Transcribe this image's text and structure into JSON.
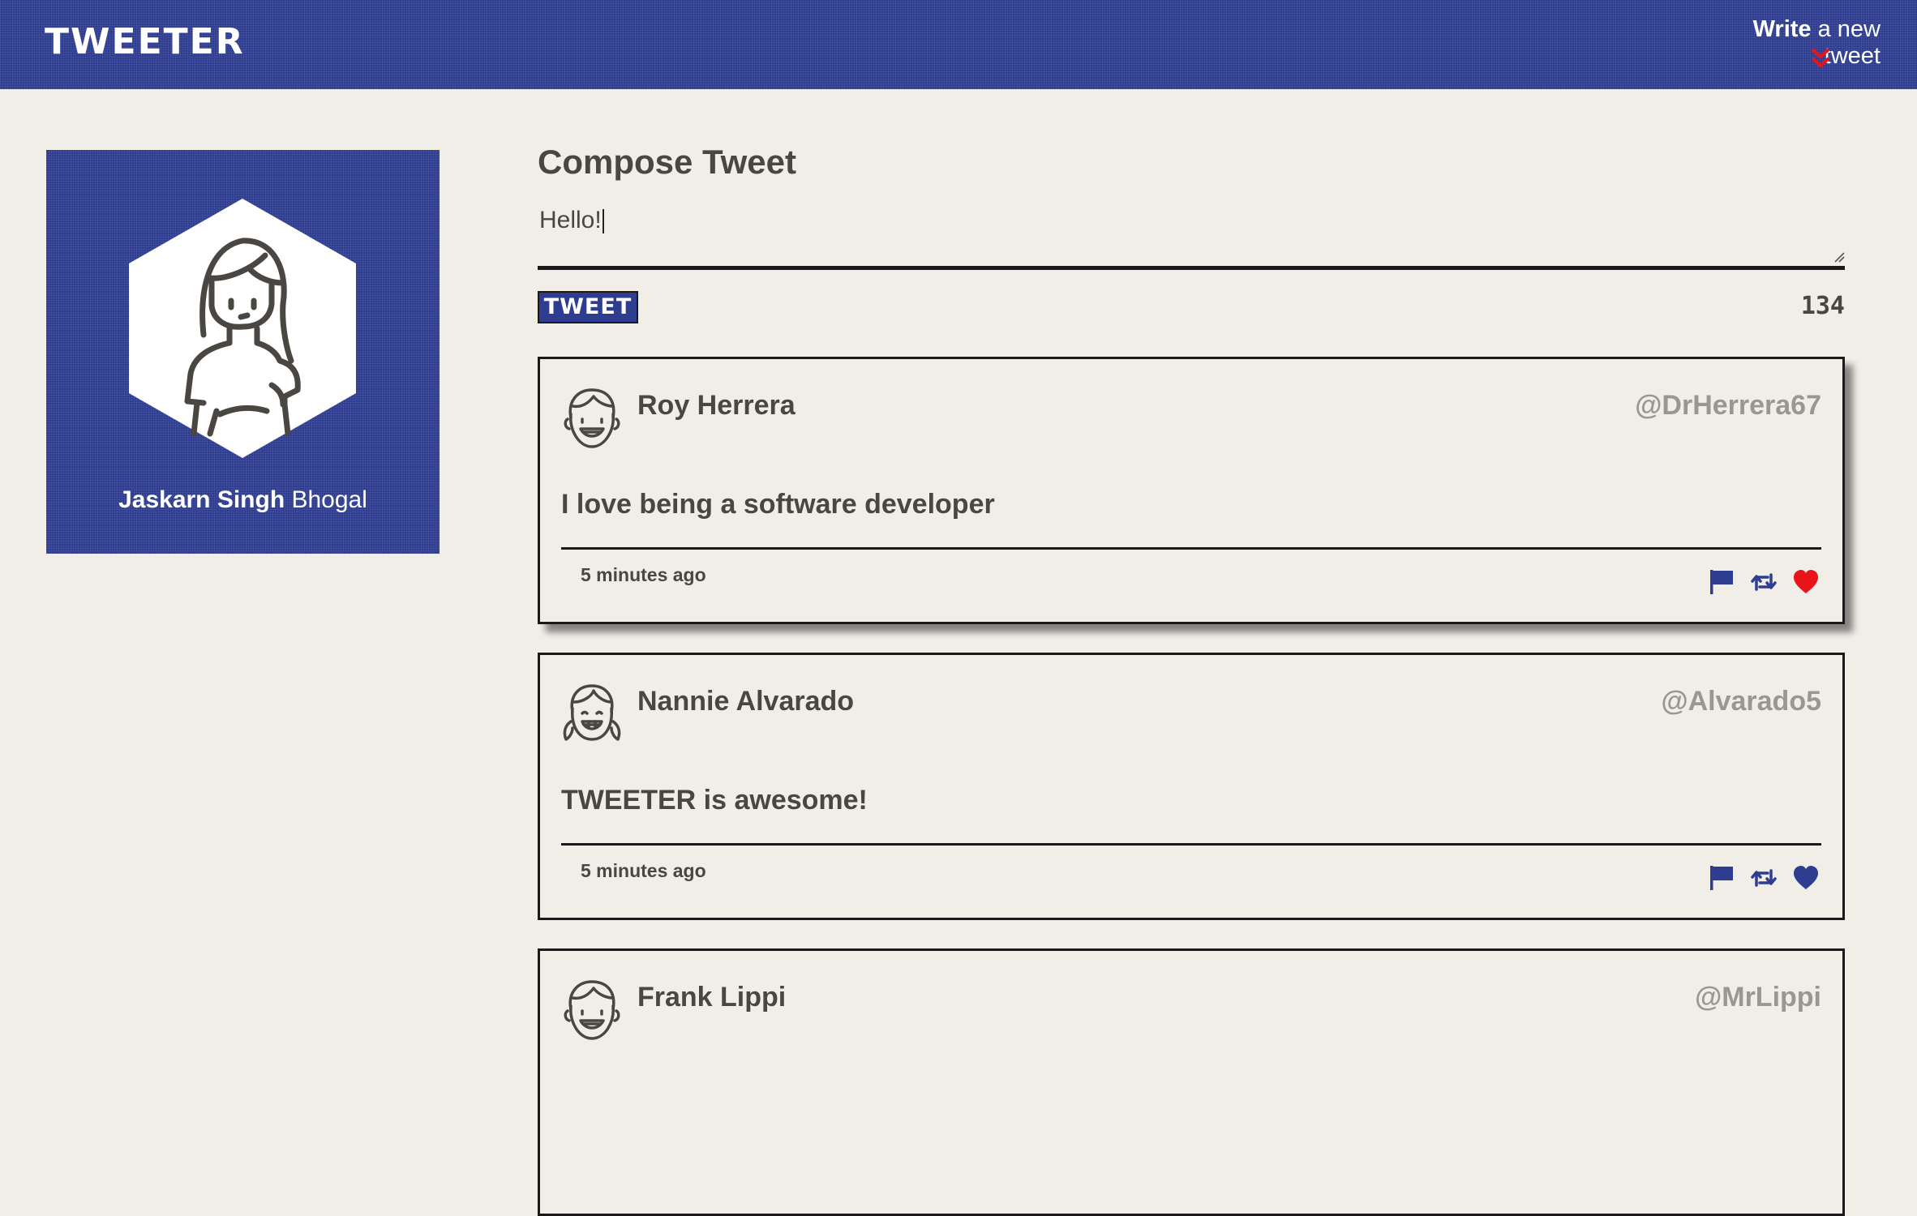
{
  "nav": {
    "brand": "TWEETER",
    "compose_bold": "Write",
    "compose_rest": " a new tweet"
  },
  "profile": {
    "first_name": "Jaskarn Singh",
    "last_name": " Bhogal"
  },
  "compose": {
    "title": "Compose Tweet",
    "text": "Hello!",
    "button_label": "TWEET",
    "counter": "134"
  },
  "colors": {
    "brand_blue": "#2e3d8f",
    "background": "#f1eee8",
    "liked_red": "#e8141a"
  },
  "tweets": [
    {
      "name": "Roy Herrera",
      "handle": "@DrHerrera67",
      "text": "I love being a software developer",
      "time": "5 minutes ago",
      "avatar_icon": "boy-avatar-icon",
      "liked": true
    },
    {
      "name": "Nannie Alvarado",
      "handle": "@Alvarado5",
      "text": "TWEETER is awesome!",
      "time": "5 minutes ago",
      "avatar_icon": "girl-avatar-icon",
      "liked": false
    },
    {
      "name": "Frank Lippi",
      "handle": "@MrLippi",
      "text": "",
      "time": "",
      "avatar_icon": "boy-avatar-icon",
      "liked": false
    }
  ]
}
